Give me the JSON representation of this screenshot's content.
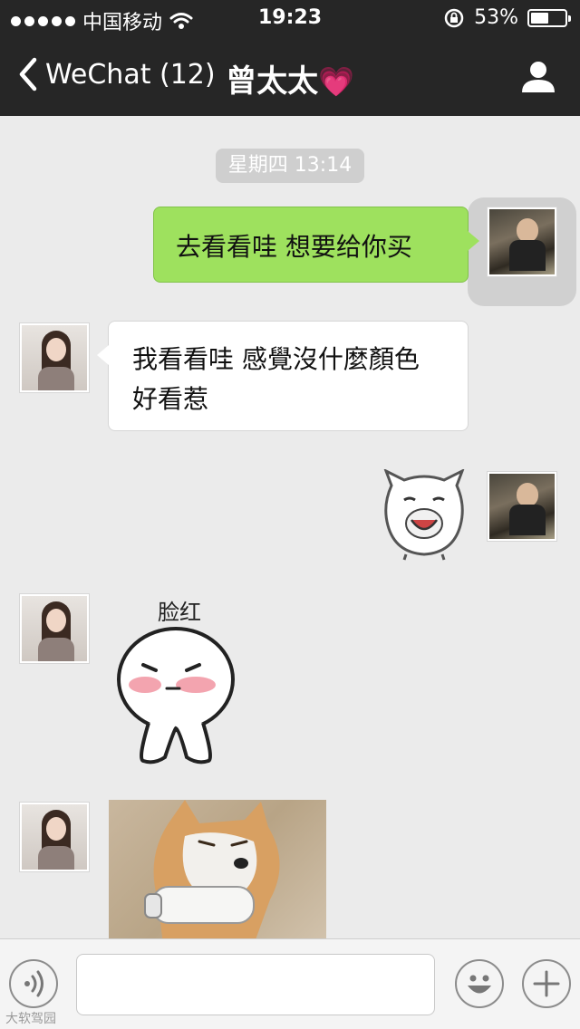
{
  "status_bar": {
    "carrier": "中国移动",
    "time": "19:23",
    "battery_text": "53%",
    "battery_level": 0.53
  },
  "nav": {
    "back_label": "WeChat (12)",
    "title": "曾太太",
    "title_emoji": "💗"
  },
  "chat": {
    "timestamp": "星期四 13:14",
    "messages": [
      {
        "from": "me",
        "type": "text",
        "text": "去看看哇 想要给你买"
      },
      {
        "from": "her",
        "type": "text",
        "text": "我看看哇 感覺沒什麼顏色好看惹"
      },
      {
        "from": "me",
        "type": "sticker",
        "sticker": "laughing-cat-face"
      },
      {
        "from": "her",
        "type": "sticker",
        "sticker": "blushing-bun",
        "caption": "脸红"
      },
      {
        "from": "her",
        "type": "image",
        "image": "shiba-dog-photo"
      }
    ]
  },
  "input": {
    "placeholder": ""
  },
  "watermark": "大软驾园",
  "colors": {
    "bar_bg": "#262626",
    "chat_bg": "#ebebeb",
    "my_bubble": "#9ee15e",
    "her_bubble": "#ffffff"
  }
}
